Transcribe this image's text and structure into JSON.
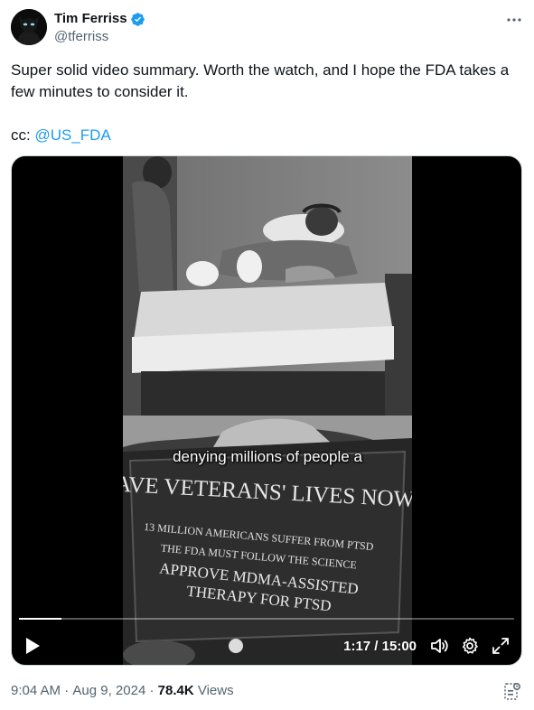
{
  "author": {
    "display_name": "Tim Ferriss",
    "handle": "@tferriss",
    "verified_color": "#1d9bf0"
  },
  "tweet": {
    "line1": "Super solid video summary. Worth the watch, and I hope the FDA takes a few minutes to consider it.",
    "cc_prefix": "cc: ",
    "mention": "@US_FDA"
  },
  "video": {
    "caption": "denying millions of people a",
    "sign_title": "SAVE VETERANS' LIVES NOW",
    "sign_line1": "13 MILLION AMERICANS SUFFER FROM PTSD",
    "sign_line2": "THE FDA MUST FOLLOW THE SCIENCE",
    "sign_line3": "APPROVE MDMA-ASSISTED",
    "sign_line4": "THERAPY FOR PTSD",
    "time_display": "1:17 / 15:00",
    "progress_fraction": 0.085
  },
  "footer": {
    "time": "9:04 AM",
    "sep1": " · ",
    "date": "Aug 9, 2024",
    "sep2": " · ",
    "views_count": "78.4K",
    "views_label": " Views"
  },
  "icons": {
    "more": "more-horizontal-icon",
    "verified": "verified-badge-icon",
    "play": "play-icon",
    "volume": "volume-icon",
    "settings": "gear-icon",
    "fullscreen": "expand-icon",
    "analytics": "analytics-icon"
  }
}
